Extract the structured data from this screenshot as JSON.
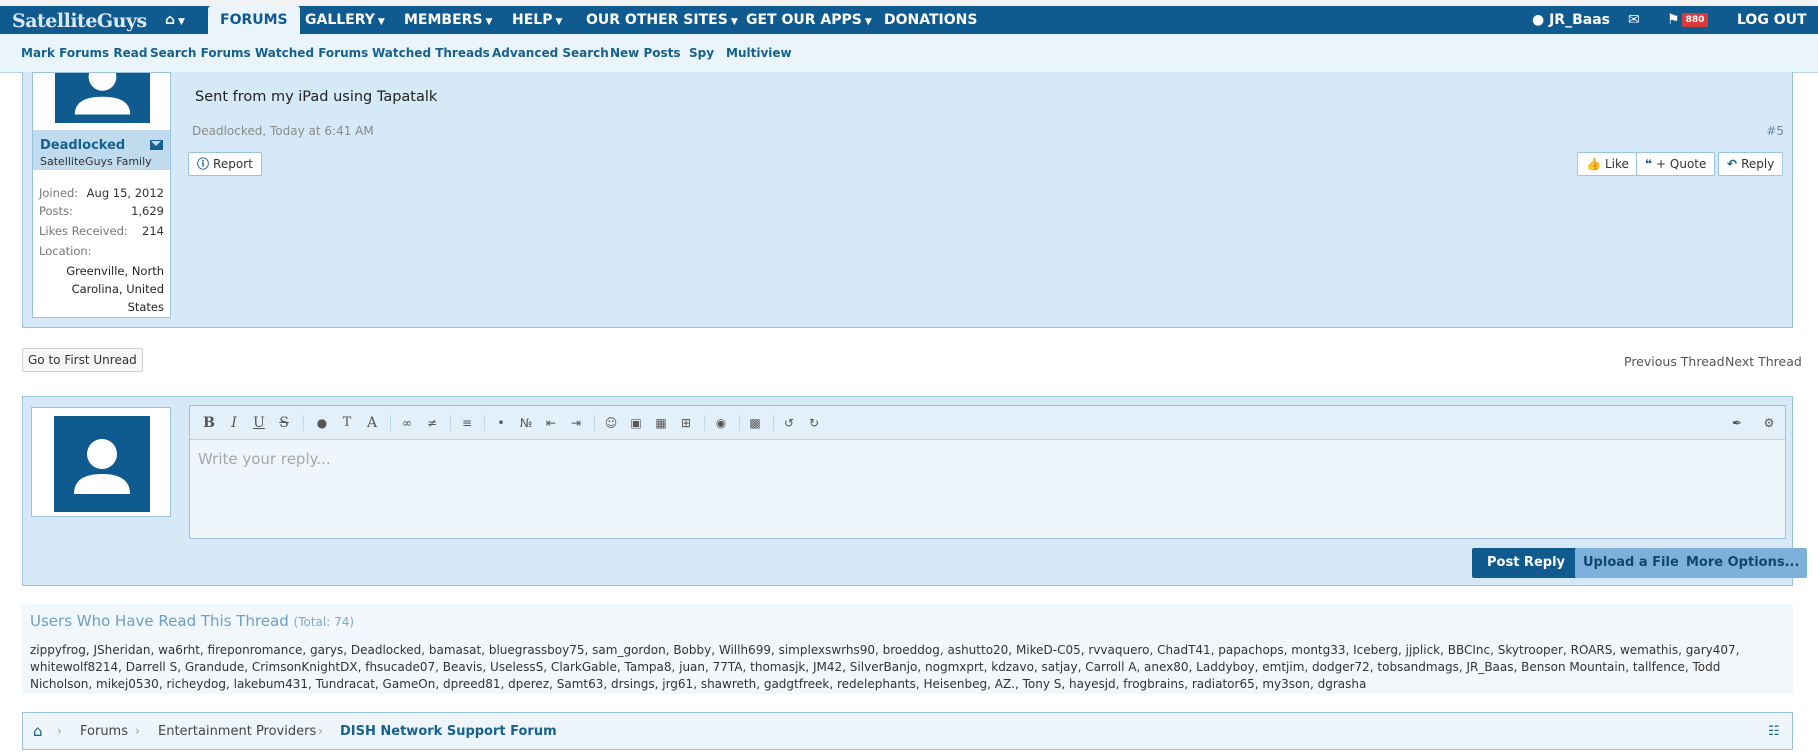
{
  "header": {
    "logo_text": "SatelliteGuys",
    "nav": [
      {
        "label": "FORUMS",
        "active": true
      },
      {
        "label": "GALLERY"
      },
      {
        "label": "MEMBERS"
      },
      {
        "label": "HELP"
      },
      {
        "label": "OUR OTHER SITES"
      },
      {
        "label": "GET OUR APPS"
      },
      {
        "label": "DONATIONS"
      }
    ],
    "user": {
      "name": "JR_Baas",
      "alerts_count": "880",
      "logout_label": "LOG OUT"
    }
  },
  "subnav": [
    "Mark Forums Read",
    "Search Forums",
    "Watched Forums",
    "Watched Threads",
    "Advanced Search",
    "New Posts",
    "Spy",
    "Multiview"
  ],
  "post": {
    "author": "Deadlocked",
    "author_title": "SatelliteGuys Family",
    "stats": [
      {
        "label": "Joined:",
        "value": "Aug 15, 2012"
      },
      {
        "label": "Posts:",
        "value": "1,629"
      },
      {
        "label": "Likes Received:",
        "value": "214"
      }
    ],
    "location_label": "Location:",
    "location_lines": [
      "Greenville, North",
      "Carolina, United",
      "States"
    ],
    "message": "Sent from my iPad using Tapatalk",
    "meta": "Deadlocked, Today at 6:41 AM",
    "number": "#5",
    "report_label": "Report",
    "like_label": "Like",
    "quote_label": "+ Quote",
    "reply_label": "Reply"
  },
  "thread_nav": {
    "first_unread": "Go to First Unread",
    "previous": "Previous Thread",
    "next": "Next Thread"
  },
  "reply": {
    "placeholder": "Write your reply...",
    "post_reply": "Post Reply",
    "upload": "Upload a File",
    "more_options": "More Options..."
  },
  "readers": {
    "title": "Users Who Have Read This Thread",
    "total": "(Total: 74)",
    "names": "zippyfrog, JSheridan, wa6rht, fireponromance, garys, Deadlocked, bamasat, bluegrassboy75, sam_gordon, Bobby, Willh699, simplexswrhs90, broeddog, ashutto20, MikeD-C05, rvvaquero, ChadT41, papachops, montg33, Iceberg, jjplick, BBCInc, Skytrooper, ROARS, wemathis, gary407, whitewolf8214, Darrell S, Grandude, CrimsonKnightDX, fhsucade07, Beavis, UselessS, ClarkGable, Tampa8, juan, 77TA, thomasjk, JM42, SilverBanjo, nogmxprt, kdzavo, satjay, Carroll A, anex80, Laddyboy, emtjim, dodger72, tobsandmags, JR_Baas, Benson Mountain, tallfence, Todd Nicholson, mikej0530, richeydog, lakebum431, Tundracat, GameOn, dpreed81, dperez, Samt63, drsings, jrg61, shawreth, gadgtfreek, redelephants, Heisenbeg, AZ., Tony S, hayesjd, frogbrains, radiator65, my3son, dgrasha"
  },
  "breadcrumb": [
    "Forums",
    "Entertainment Providers",
    "DISH Network Support Forum"
  ]
}
